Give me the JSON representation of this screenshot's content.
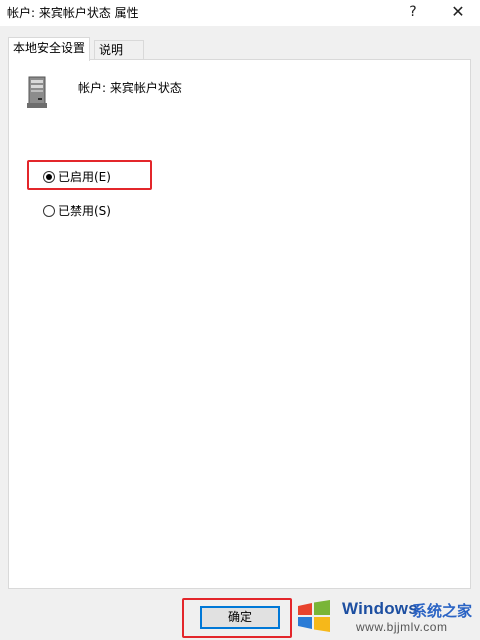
{
  "window": {
    "title": "帐户: 来宾帐户状态 属性",
    "help_glyph": "?",
    "close_glyph": "✕"
  },
  "tabs": [
    {
      "label": "本地安全设置",
      "active": true
    },
    {
      "label": "说明",
      "active": false
    }
  ],
  "policy": {
    "icon": "server-policy-icon",
    "name": "帐户: 来宾帐户状态"
  },
  "options": [
    {
      "label": "已启用(E)",
      "checked": true
    },
    {
      "label": "已禁用(S)",
      "checked": false
    }
  ],
  "buttons": {
    "ok_label": "确定"
  },
  "watermark": {
    "brand": "Windows",
    "site_name": "系统之家",
    "url": "www.bjjmlv.com"
  },
  "colors": {
    "highlight": "#e3262b",
    "focus_border": "#0078d7",
    "panel_bg": "#ffffff",
    "window_bg": "#f0f0f0"
  }
}
